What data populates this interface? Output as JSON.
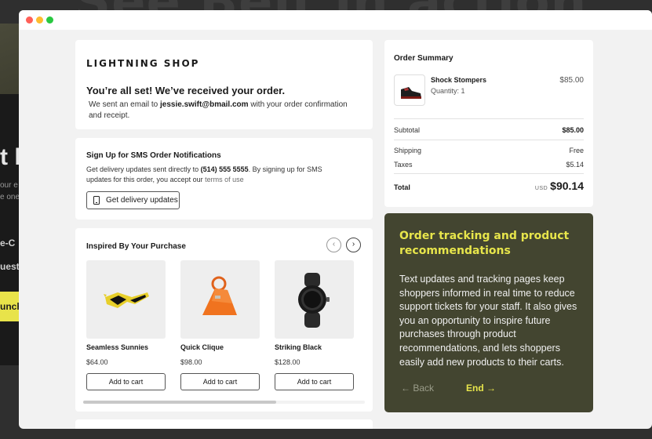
{
  "background": {
    "headline": "See Belt in action",
    "side_text": [
      "t l",
      "our e",
      "e one",
      "e-C",
      "uest",
      "unch"
    ]
  },
  "shop": {
    "name": "LIGHTNING SHOP",
    "confirm_title": "You’re all set! We’ve received your order.",
    "confirm_text_pre": "We sent an email to ",
    "confirm_email": "jessie.swift@bmail.com",
    "confirm_text_post": " with your order confirmation and receipt."
  },
  "sms": {
    "title": "Sign Up for SMS Order Notifications",
    "text_pre": "Get delivery updates sent directly to ",
    "phone": "(514) 555 5555",
    "text_mid": ". By signing up for SMS updates for this order, you accept our ",
    "terms_link": "terms of use",
    "button_label": "Get delivery updates",
    "button_icon": "phone-icon"
  },
  "inspired": {
    "title": "Inspired By Your Purchase",
    "prev_icon": "‹",
    "next_icon": "›",
    "products": [
      {
        "name": "Seamless Sunnies",
        "price": "$64.00",
        "button": "Add to cart",
        "icon": "sunglasses"
      },
      {
        "name": "Quick Clique",
        "price": "$98.00",
        "button": "Add to cart",
        "icon": "handbag"
      },
      {
        "name": "Striking Black",
        "price": "$128.00",
        "button": "Add to cart",
        "icon": "smartwatch"
      }
    ]
  },
  "summary": {
    "title": "Order Summary",
    "item_name": "Shock Stompers",
    "item_qty": "Quantity: 1",
    "item_price": "$85.00",
    "subtotal_label": "Subtotal",
    "subtotal_value": "$85.00",
    "shipping_label": "Shipping",
    "shipping_value": "Free",
    "taxes_label": "Taxes",
    "taxes_value": "$5.14",
    "total_label": "Total",
    "total_currency": "USD",
    "total_value": "$90.14"
  },
  "info": {
    "title": "Order tracking and product recommendations",
    "body": "Text updates and tracking pages keep shoppers informed in real time to reduce support tickets for your staff. It also gives you an opportunity to inspire future purchases through product recommendations, and lets shoppers easily add new products to their carts.",
    "back_label": "← Back",
    "end_label": "End →"
  },
  "colors": {
    "accent_yellow": "#e7e54b",
    "panel_olive": "#434530",
    "window_bg": "#f2f2f2"
  }
}
